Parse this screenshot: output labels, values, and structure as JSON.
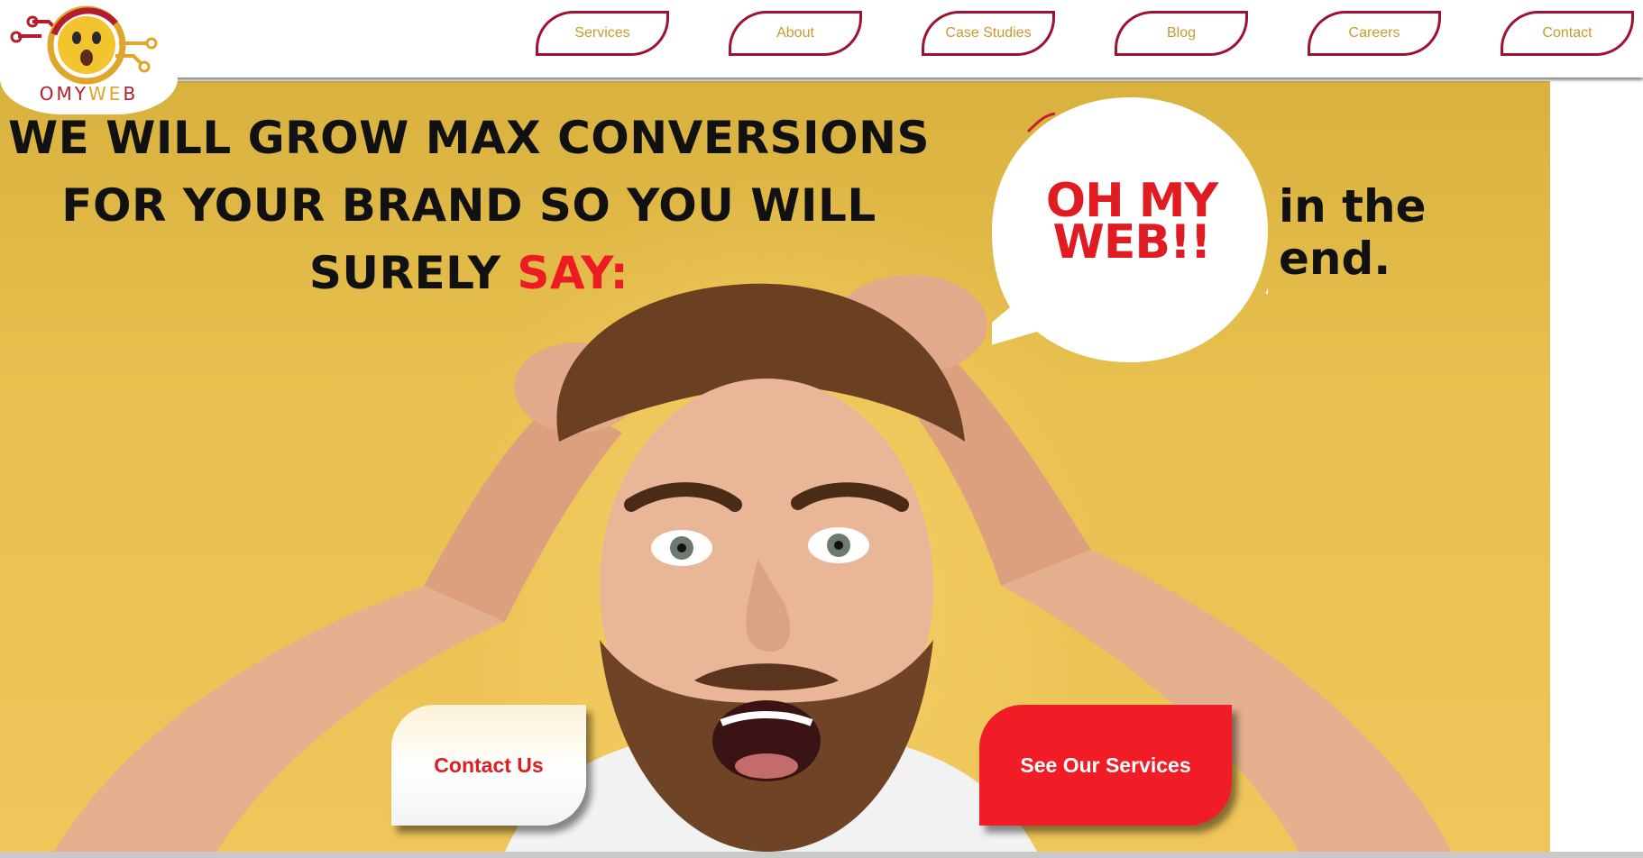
{
  "brand": {
    "logo_text_o": "O",
    "logo_text_my": "MY",
    "logo_text_we": "WE",
    "logo_text_b": "B",
    "colors": {
      "red": "#b51d2e",
      "gold": "#e0a52a",
      "nav_text": "#c89a2e",
      "accent_red": "#ed1c24"
    }
  },
  "nav": {
    "items": [
      {
        "label": "Services"
      },
      {
        "label": "About"
      },
      {
        "label": "Case Studies"
      },
      {
        "label": "Blog"
      },
      {
        "label": "Careers"
      },
      {
        "label": "Contact"
      }
    ]
  },
  "hero": {
    "headline_line1": "WE WILL GROW MAX CONVERSIONS",
    "headline_line2": "FOR YOUR BRAND SO YOU WILL",
    "headline_line3_prefix": "SURELY ",
    "headline_line3_highlight": "SAY:",
    "bubble_line1": "OH MY",
    "bubble_line2": "WEB!!",
    "tagline": "in the end.",
    "contact_button": "Contact Us",
    "services_button": "See Our Services"
  }
}
